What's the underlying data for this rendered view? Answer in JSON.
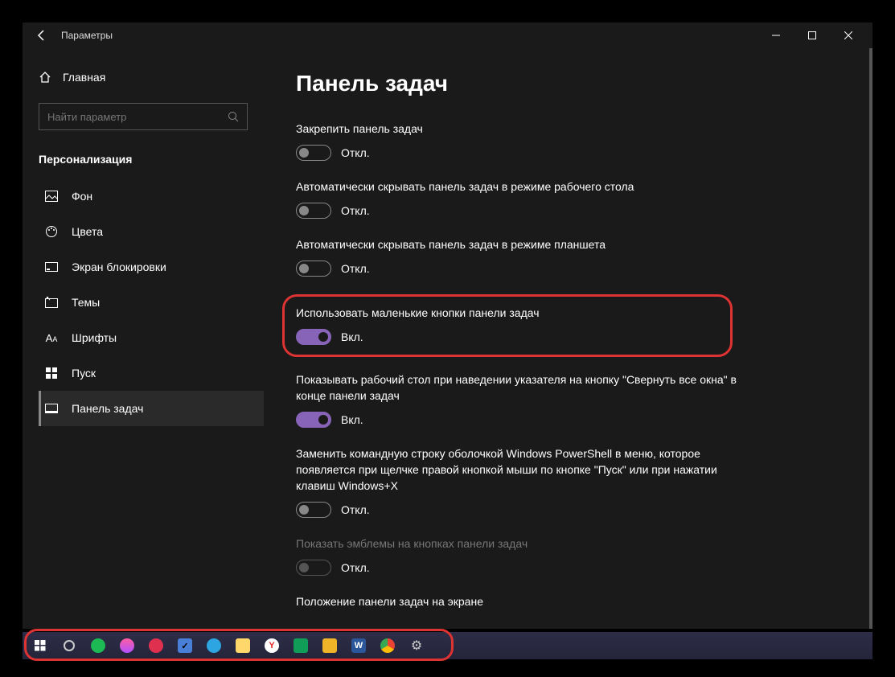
{
  "window": {
    "title": "Параметры"
  },
  "sidebar": {
    "home": "Главная",
    "search_placeholder": "Найти параметр",
    "section": "Персонализация",
    "items": [
      {
        "label": "Фон"
      },
      {
        "label": "Цвета"
      },
      {
        "label": "Экран блокировки"
      },
      {
        "label": "Темы"
      },
      {
        "label": "Шрифты"
      },
      {
        "label": "Пуск"
      },
      {
        "label": "Панель задач"
      }
    ]
  },
  "page": {
    "title": "Панель задач"
  },
  "settings": {
    "lock_taskbar": {
      "label": "Закрепить панель задач",
      "state": "Откл."
    },
    "autohide_desktop": {
      "label": "Автоматически скрывать панель задач в режиме рабочего стола",
      "state": "Откл."
    },
    "autohide_tablet": {
      "label": "Автоматически скрывать панель задач в режиме планшета",
      "state": "Откл."
    },
    "small_buttons": {
      "label": "Использовать маленькие кнопки панели задач",
      "state": "Вкл."
    },
    "peek_desktop": {
      "label": "Показывать рабочий стол при наведении указателя на кнопку \"Свернуть все окна\" в конце панели задач",
      "state": "Вкл."
    },
    "powershell": {
      "label": "Заменить командную строку оболочкой Windows PowerShell в меню, которое появляется при щелчке правой кнопкой мыши по кнопке \"Пуск\" или при нажатии клавиш Windows+X",
      "state": "Откл."
    },
    "badges": {
      "label": "Показать эмблемы на кнопках панели задач",
      "state": "Откл."
    },
    "position": {
      "label": "Положение панели задач на экране"
    }
  },
  "colors": {
    "accent": "#8764b8"
  }
}
